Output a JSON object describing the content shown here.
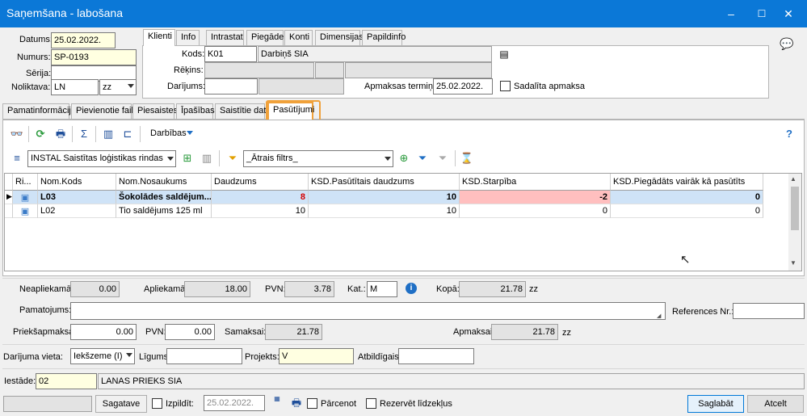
{
  "window": {
    "title": "Saņemšana - labošana",
    "minimize": "–",
    "maximize": "☐",
    "close": "✕"
  },
  "header": {
    "datums_label": "Datums:",
    "datums": "25.02.2022.",
    "numurs_label": "Numurs:",
    "numurs": "SP-0193",
    "serija_label": "Sērija:",
    "serija": "",
    "noliktava_label": "Noliktava:",
    "noliktava": "LN",
    "noliktava2": "zz"
  },
  "client_tabs": [
    "Klienti",
    "Info",
    "Intrastat",
    "Piegāde",
    "Konti",
    "Dimensijas",
    "Papildinfo"
  ],
  "client": {
    "kods_label": "Kods:",
    "kods": "K01",
    "nosaukums": "Darbiņš SIA",
    "rekins_label": "Rēķins:",
    "darijums_label": "Darījums:",
    "termins_label": "Apmaksas termiņš:",
    "termins": "25.02.2022.",
    "sadalita_label": "Sadalīta apmaksa"
  },
  "main_tabs": [
    "Pamatinformācija",
    "Pievienotie faili",
    "Piesaistes",
    "Īpašības",
    "Saistītie dati",
    "Pasūtījumi"
  ],
  "toolbar": {
    "darbibas": "Darbības",
    "view_select": "INSTAL Saistītas loģistikas rindas",
    "filter_select": "_Ātrais filtrs_"
  },
  "grid": {
    "headers": [
      "Ri...",
      "Nom.Kods",
      "Nom.Nosaukums",
      "Daudzums",
      "KSD.Pasūtītais daudzums",
      "KSD.Starpība",
      "KSD.Piegādāts vairāk kā pasūtīts"
    ],
    "rows": [
      {
        "kods": "L03",
        "nosaukums": "Šokolādes saldējum...",
        "daudzums": "8",
        "pasutitais": "10",
        "starpiba": "-2",
        "vairak": "0"
      },
      {
        "kods": "L02",
        "nosaukums": "Tio saldējums 125 ml",
        "daudzums": "10",
        "pasutitais": "10",
        "starpiba": "0",
        "vairak": "0"
      }
    ],
    "colors": {
      "selected": "#cfe3f7",
      "negative": "#ffbfbf",
      "red_text": "#d40000"
    }
  },
  "totals": {
    "neapliekama_label": "Neapliekamā:",
    "neapliekama": "0.00",
    "apliekama_label": "Apliekamā:",
    "apliekama": "18.00",
    "pvn_label": "PVN:",
    "pvn": "3.78",
    "kat_label": "Kat.:",
    "kat": "M",
    "kopa_label": "Kopā:",
    "kopa": "21.78",
    "currency": "zz",
    "pamatojums_label": "Pamatojums:",
    "pamatojums": "",
    "references_label": "References Nr.:",
    "references": "",
    "priekšapmaksa_label": "Priekšapmaksa:",
    "priekšapmaksa": "0.00",
    "pvn2_label": "PVN:",
    "pvn2": "0.00",
    "samaksai_label": "Samaksai:",
    "samaksai": "21.78",
    "apmaksai_label": "Apmaksai:",
    "apmaksai": "21.78",
    "currency2": "zz"
  },
  "deal": {
    "vieta_label": "Darījuma vieta:",
    "vieta": "Iekšzeme (I)",
    "ligums_label": "Līgums:",
    "ligums": "",
    "projekts_label": "Projekts:",
    "projekts": "V",
    "atbildigais_label": "Atbildīgais:",
    "atbildigais": "",
    "iestade_label": "Iestāde:",
    "iestade": "02",
    "iestade_name": "LANAS PRIEKS SIA"
  },
  "footer": {
    "status": "Sagatave",
    "izpildit_label": "Izpildīt:",
    "izpildit_date": "25.02.2022.",
    "parcenot_label": "Pārcenot",
    "rezervet_label": "Rezervēt līdzekļus",
    "save": "Saglabāt",
    "cancel": "Atcelt"
  }
}
